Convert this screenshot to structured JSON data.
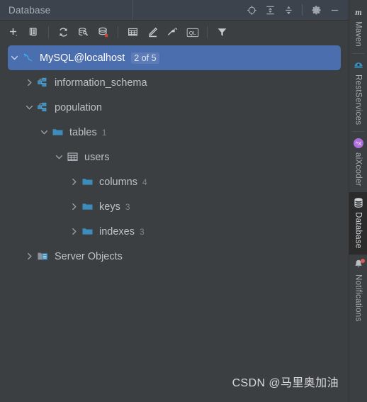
{
  "window": {
    "tab_title": "Database"
  },
  "header_actions": [
    {
      "name": "locate-icon",
      "tooltip": "Scroll from Source"
    },
    {
      "name": "expand-all-icon",
      "tooltip": "Expand All"
    },
    {
      "name": "collapse-all-icon",
      "tooltip": "Collapse All"
    },
    {
      "name": "settings-gear-icon",
      "tooltip": "Settings"
    },
    {
      "name": "minimize-icon",
      "tooltip": "Hide"
    }
  ],
  "toolbar": [
    {
      "name": "add-button",
      "tooltip": "New"
    },
    {
      "name": "duplicate-button",
      "tooltip": "Duplicate"
    },
    {
      "name": "refresh-button",
      "tooltip": "Refresh"
    },
    {
      "name": "datasource-properties-button",
      "tooltip": "Data Source Properties"
    },
    {
      "name": "sync-database-button",
      "tooltip": "Synchronize"
    },
    {
      "name": "open-table-editor-button",
      "tooltip": "Open Table Editor"
    },
    {
      "name": "modify-object-button",
      "tooltip": "Modify Object"
    },
    {
      "name": "jump-to-source-button",
      "tooltip": "Jump to Source"
    },
    {
      "name": "query-console-button",
      "label": "QL",
      "tooltip": "Open Query Console"
    },
    {
      "name": "filter-button",
      "tooltip": "Filter"
    }
  ],
  "tree": {
    "nodes": [
      {
        "label": "MySQL@localhost",
        "icon": "mysql-dolphin-icon",
        "indent": 0,
        "expanded": true,
        "selected": true,
        "badge": "2 of 5",
        "count": ""
      },
      {
        "label": "information_schema",
        "icon": "schema-icon",
        "indent": 1,
        "expanded": false,
        "selected": false,
        "badge": "",
        "count": ""
      },
      {
        "label": "population",
        "icon": "schema-icon",
        "indent": 1,
        "expanded": true,
        "selected": false,
        "badge": "",
        "count": ""
      },
      {
        "label": "tables",
        "icon": "folder-icon",
        "indent": 2,
        "expanded": true,
        "selected": false,
        "badge": "",
        "count": "1"
      },
      {
        "label": "users",
        "icon": "table-grid-icon",
        "indent": 3,
        "expanded": true,
        "selected": false,
        "badge": "",
        "count": ""
      },
      {
        "label": "columns",
        "icon": "folder-icon",
        "indent": 4,
        "expanded": false,
        "selected": false,
        "badge": "",
        "count": "4"
      },
      {
        "label": "keys",
        "icon": "folder-icon",
        "indent": 4,
        "expanded": false,
        "selected": false,
        "badge": "",
        "count": "3"
      },
      {
        "label": "indexes",
        "icon": "folder-icon",
        "indent": 4,
        "expanded": false,
        "selected": false,
        "badge": "",
        "count": "3"
      },
      {
        "label": "Server Objects",
        "icon": "server-objects-icon",
        "indent": 1,
        "expanded": false,
        "selected": false,
        "badge": "",
        "count": ""
      }
    ]
  },
  "stripe": {
    "items": [
      {
        "label": "Maven",
        "icon": "maven-m-icon",
        "active": false,
        "notification": false
      },
      {
        "label": "RestServices",
        "icon": "rest-services-icon",
        "active": false,
        "notification": false
      },
      {
        "label": "aiXcoder",
        "icon": "aixcoder-icon",
        "active": false,
        "notification": false
      },
      {
        "label": "Database",
        "icon": "database-icon",
        "active": true,
        "notification": false
      },
      {
        "label": "Notifications",
        "icon": "bell-icon",
        "active": false,
        "notification": true
      }
    ]
  },
  "watermark": {
    "text": "CSDN @马里奥加油"
  },
  "colors": {
    "panel_bg": "#3c3f41",
    "header_bg": "#3c434d",
    "selection_blue": "#4b6eaf",
    "accent_cyan": "#3592c4",
    "text_primary": "#bcc1c7",
    "text_muted": "#7e858d",
    "red_dot": "#e05a4f",
    "aixcoder_purple": "#b06fdc"
  }
}
